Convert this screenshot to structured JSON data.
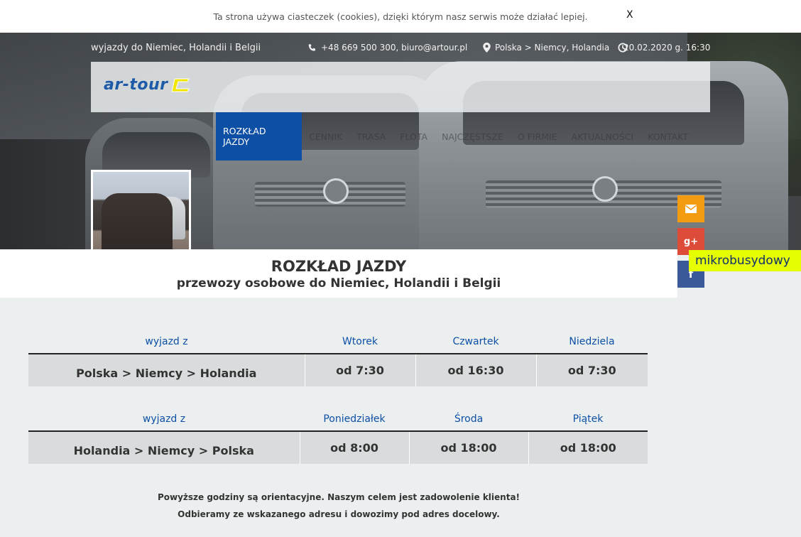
{
  "cookie_bar": {
    "text": "Ta strona używa ciasteczek (cookies), dzięki którym nasz serwis może działać lepiej.",
    "close_label": "X"
  },
  "topbar": {
    "tagline": "wyjazdy do Niemiec, Holandii i Belgii",
    "contact": "+48 669 500 300, biuro@artour.pl",
    "location": "Polska > Niemcy, Holandia",
    "datetime": "20.02.2020 g. 16:30"
  },
  "logo": {
    "text": "ar-tour",
    "brand_color": "#1d5aa8",
    "mark_color": "#f0e600"
  },
  "nav": {
    "items": [
      {
        "label": "Rozkład jazdy",
        "active": true
      },
      {
        "label": "Cennik"
      },
      {
        "label": "Trasa"
      },
      {
        "label": "Flota"
      },
      {
        "label": "Najczęstsze"
      },
      {
        "label": "O firmie"
      },
      {
        "label": "Aktualności"
      },
      {
        "label": "Kontakt"
      }
    ],
    "active_color": "#0d4fa5"
  },
  "social": {
    "mail_color": "#f39c12",
    "gplus_label": "g+",
    "gplus_color": "#dd4b39",
    "fb_label": "f",
    "fb_color": "#3b5998",
    "mikro_label": "mikrobusydowy"
  },
  "title": {
    "main": "ROZKŁAD JAZDY",
    "subtitle": "przewozy osobowe do Niemiec, Holandii i Belgii"
  },
  "schedule1": {
    "headers": [
      "wyjazd z",
      "Wtorek",
      "Czwartek",
      "Niedziela"
    ],
    "row": [
      "Polska > Niemcy > Holandia",
      "od 7:30",
      "od 16:30",
      "od 7:30"
    ]
  },
  "schedule2": {
    "headers": [
      "wyjazd z",
      "Poniedziałek",
      "Środa",
      "Piątek"
    ],
    "row": [
      "Holandia > Niemcy > Polska",
      "od 8:00",
      "od 18:00",
      "od 18:00"
    ]
  },
  "notes": {
    "line1": "Powyższe godziny są orientacyjne. Naszym celem jest zadowolenie klienta!",
    "line2": "Odbieramy ze wskazanego adresu i dowozimy pod adres docelowy."
  }
}
